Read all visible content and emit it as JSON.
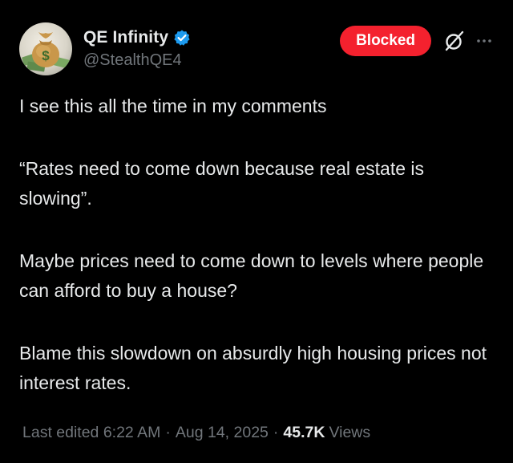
{
  "author": {
    "display_name": "QE Infinity",
    "handle": "@StealthQE4",
    "verified": true,
    "avatar_icon": "money-bag-icon"
  },
  "actions": {
    "blocked_label": "Blocked",
    "blocked_color": "#f4212e",
    "grok_icon": "grok-icon",
    "more_icon": "more-dots-icon"
  },
  "post": {
    "paragraphs": [
      "I see this all the time in my comments",
      "“Rates need to come down because real estate is slowing”.",
      "Maybe prices need to come down to levels where people can afford to buy a house?",
      "Blame this slowdown on absurdly high housing prices not interest rates."
    ]
  },
  "meta": {
    "edited_label": "Last edited 6:22 AM",
    "separator": "·",
    "date": "Aug 14, 2025",
    "views_count": "45.7K",
    "views_label": "Views"
  },
  "colors": {
    "background": "#000000",
    "text_primary": "#e7e9ea",
    "text_secondary": "#71767b",
    "verified_blue": "#1d9bf0"
  }
}
